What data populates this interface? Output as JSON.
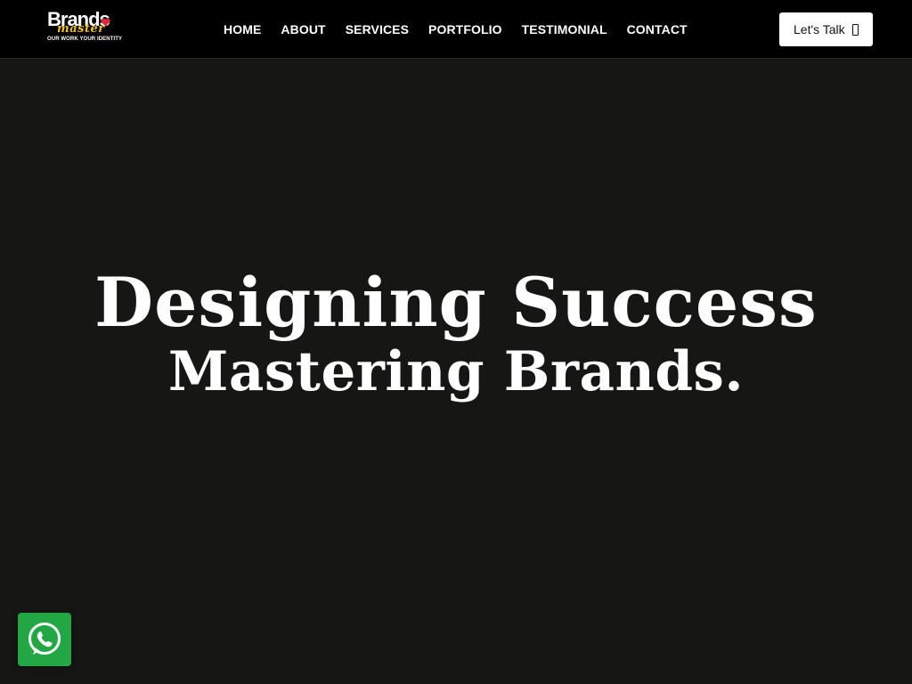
{
  "logo": {
    "word": "Brands",
    "script": "master",
    "tagline": "OUR WORK YOUR IDENTITY"
  },
  "nav": {
    "items": [
      "HOME",
      "ABOUT",
      "SERVICES",
      "PORTFOLIO",
      "TESTIMONIAL",
      "CONTACT"
    ]
  },
  "cta": {
    "label": "Let's Talk",
    "icon": "arrow-icon"
  },
  "hero": {
    "line1": "Designing Success",
    "line2": "Mastering Brands."
  },
  "whatsapp": {
    "icon": "whatsapp-icon",
    "color": "#23a644"
  },
  "colors": {
    "header_bg": "#000000",
    "page_bg": "#161614",
    "accent_yellow": "#f2c21a",
    "heart_red": "#e0243a"
  }
}
